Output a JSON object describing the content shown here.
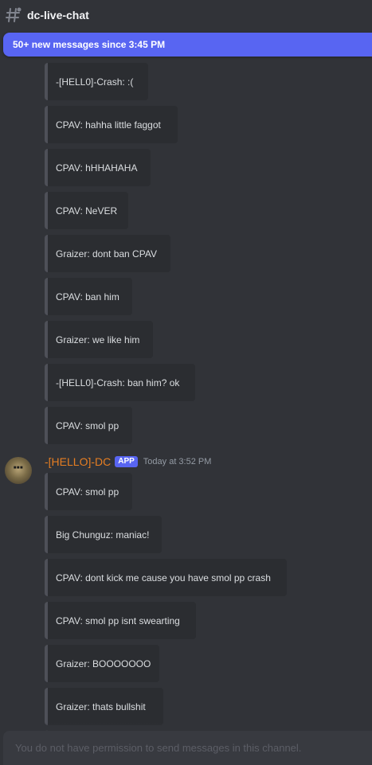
{
  "channel": {
    "name": "dc-live-chat",
    "icon": "text-channel-hash-icon"
  },
  "banner": {
    "text": "50+ new messages since 3:45 PM"
  },
  "earlier_messages": [
    "-[HELL0]-Crash: :(",
    "CPAV: hahha little faggot",
    "CPAV: hHHAHAHA",
    "CPAV: NeVER",
    "Graizer: dont ban CPAV",
    "CPAV: ban him",
    "Graizer: we like him",
    "-[HELL0]-Crash: ban him? ok",
    "CPAV: smol pp"
  ],
  "author": {
    "name": "-[HELLO]-DC",
    "badge": "APP",
    "timestamp": "Today at 3:52 PM",
    "name_color": "#e67e22"
  },
  "later_messages": [
    "CPAV: smol pp",
    "Big Chunguz: maniac!",
    "CPAV: dont kick me cause you have smol pp crash",
    "CPAV: smol pp isnt swearting",
    "Graizer: BOOOOOOO",
    "Graizer: thats bullshit"
  ],
  "composer": {
    "placeholder": "You do not have permission to send messages in this channel."
  },
  "colors": {
    "background": "#313338",
    "embed": "#2b2d31",
    "accent": "#5865f2"
  }
}
